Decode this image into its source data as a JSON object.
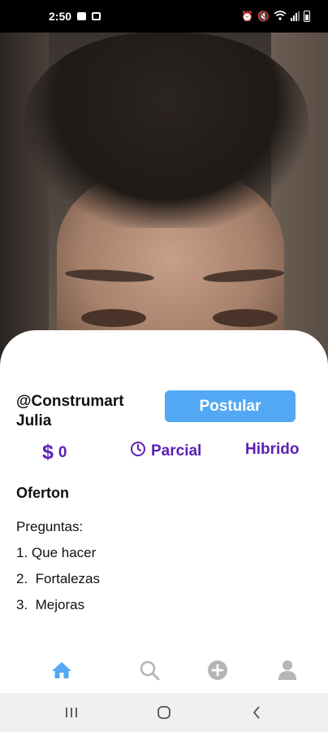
{
  "status_bar": {
    "time": "2:50"
  },
  "post": {
    "handle": "@Construmart",
    "name": "Julia",
    "apply_label": "Postular",
    "salary": "0",
    "schedule": "Parcial",
    "modality": "Hibrido",
    "title": "Oferton",
    "description_lines": [
      "Preguntas:",
      "1. Que hacer",
      "2.  Fortalezas",
      "3.  Mejoras"
    ]
  },
  "bottom_nav": {
    "active": "home",
    "items": [
      "home-icon",
      "search-icon",
      "add-circle-icon",
      "profile-icon"
    ]
  },
  "colors": {
    "accent_blue": "#52a8f2",
    "accent_purple": "#5b21b6",
    "inactive_icon": "#b5b5b5"
  }
}
